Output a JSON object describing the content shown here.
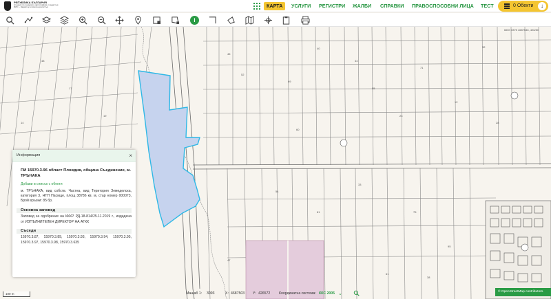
{
  "header": {
    "logo_line1": "РЕПУБЛИКА БЪЛГАРИЯ",
    "logo_line2": "Агенция по геодезия, картография и кадастър",
    "logo_line3": "ИИС – Кадастър и имотен регистър",
    "nav": [
      "КАРТА",
      "УСЛУГИ",
      "РЕГИСТРИ",
      "ЖАЛБИ",
      "СПРАВКИ",
      "ПРАВОСПОСОБНИ ЛИЦА",
      "ТЕСТ"
    ],
    "active_nav": "КАРТА",
    "objects_label": "0 Обекти"
  },
  "toolbar": {
    "icons": [
      "search-icon",
      "measure-icon",
      "layers-icon",
      "layers-alt-icon",
      "zoom-in-icon",
      "zoom-out-icon",
      "pan-icon",
      "marker-icon",
      "select-rect-icon",
      "select-area-icon",
      "info-icon",
      "line-icon",
      "polygon-icon",
      "map-icon",
      "crosshair-icon",
      "clipboard-icon",
      "print-icon"
    ],
    "coord_ref": "6657.3375 4687546, 426/80"
  },
  "info_panel": {
    "header": "Информация",
    "title": "ПИ 15970.3.96 област Пловдив, община Съединение, м. ТРЪНАКА",
    "add_link": "Добави в списък с обекти",
    "description": "м. ТРЪНАКА, вид собств. Частна, вид Територия Земеделска, категория 3, НТП Пасище, площ 38786 кв. м, стар номер 000073, Брой връзки: 85 бр.",
    "section_order": "Основна заповед",
    "order_text": "Заповед за одобрение на КККР РД-18-814/25.11.2019 г., издадена от ИЗПЪЛНИТЕЛЕН ДИРЕКТОР НА АГКК",
    "section_neighbors": "Съседи",
    "neighbors": "15970.3.87, 15970.3.89, 15970.3.93, 15970.3.94, 15970.3.95, 15970.3.97, 15970.3.98, 15970.3.635"
  },
  "bottom_bar": {
    "scale_label": "Мащаб 1:",
    "scale_value": "3093",
    "x_label": "X:",
    "x_value": "4687503",
    "y_label": "Y:",
    "y_value": "426572",
    "system_label": "Координатна система:",
    "system_value": "ККС 2005"
  },
  "scalebar": "100 m",
  "osm_credit": "© OpenStreetMap contributors.",
  "colors": {
    "accent_green": "#2a9b45",
    "accent_yellow": "#f4c531",
    "selected_parcel_fill": "#c6d3ee",
    "selected_parcel_stroke": "#2fb8e6",
    "pink_area": "#e4ccdc"
  }
}
